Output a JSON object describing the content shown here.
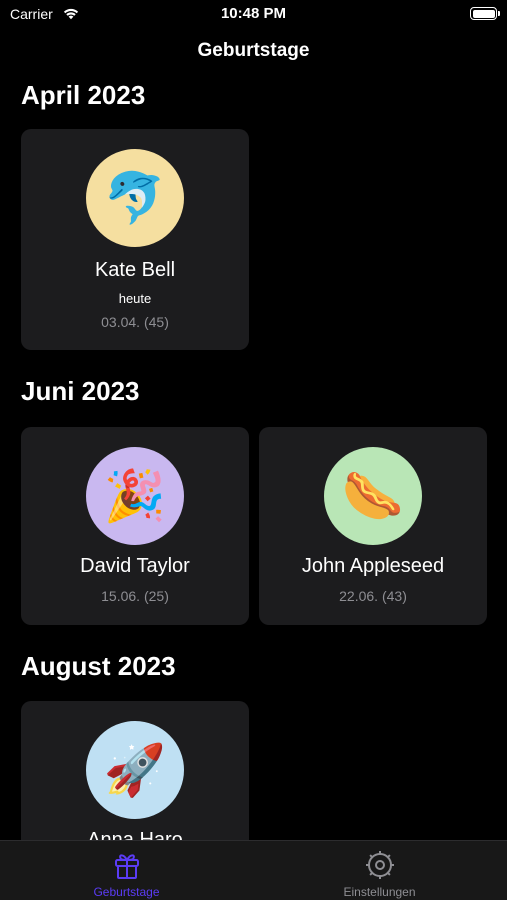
{
  "status_bar": {
    "carrier": "Carrier",
    "time": "10:48 PM",
    "wifi_icon": "wifi-icon",
    "battery_icon": "battery-icon"
  },
  "nav": {
    "title": "Geburtstage"
  },
  "sections": [
    {
      "title": "April 2023",
      "cards": [
        {
          "name": "Kate Bell",
          "sub": "heute",
          "date": "03.04. (45)",
          "emoji": "🐬",
          "avatar_color": "#f5dfa0"
        }
      ]
    },
    {
      "title": "Juni 2023",
      "cards": [
        {
          "name": "David Taylor",
          "date": "15.06. (25)",
          "emoji": "🎉",
          "avatar_color": "#c9b8f0"
        },
        {
          "name": "John Appleseed",
          "date": "22.06. (43)",
          "emoji": "🌭",
          "avatar_color": "#b9e6b6"
        }
      ]
    },
    {
      "title": "August 2023",
      "cards": [
        {
          "name": "Anna Haro",
          "emoji": "🚀",
          "avatar_color": "#bfe0f3"
        }
      ]
    }
  ],
  "tabs": [
    {
      "label": "Geburtstage",
      "icon": "gift-icon",
      "active": true,
      "color": "#5b3cf5"
    },
    {
      "label": "Einstellungen",
      "icon": "gear-icon",
      "active": false,
      "color": "#8e8e93"
    }
  ]
}
